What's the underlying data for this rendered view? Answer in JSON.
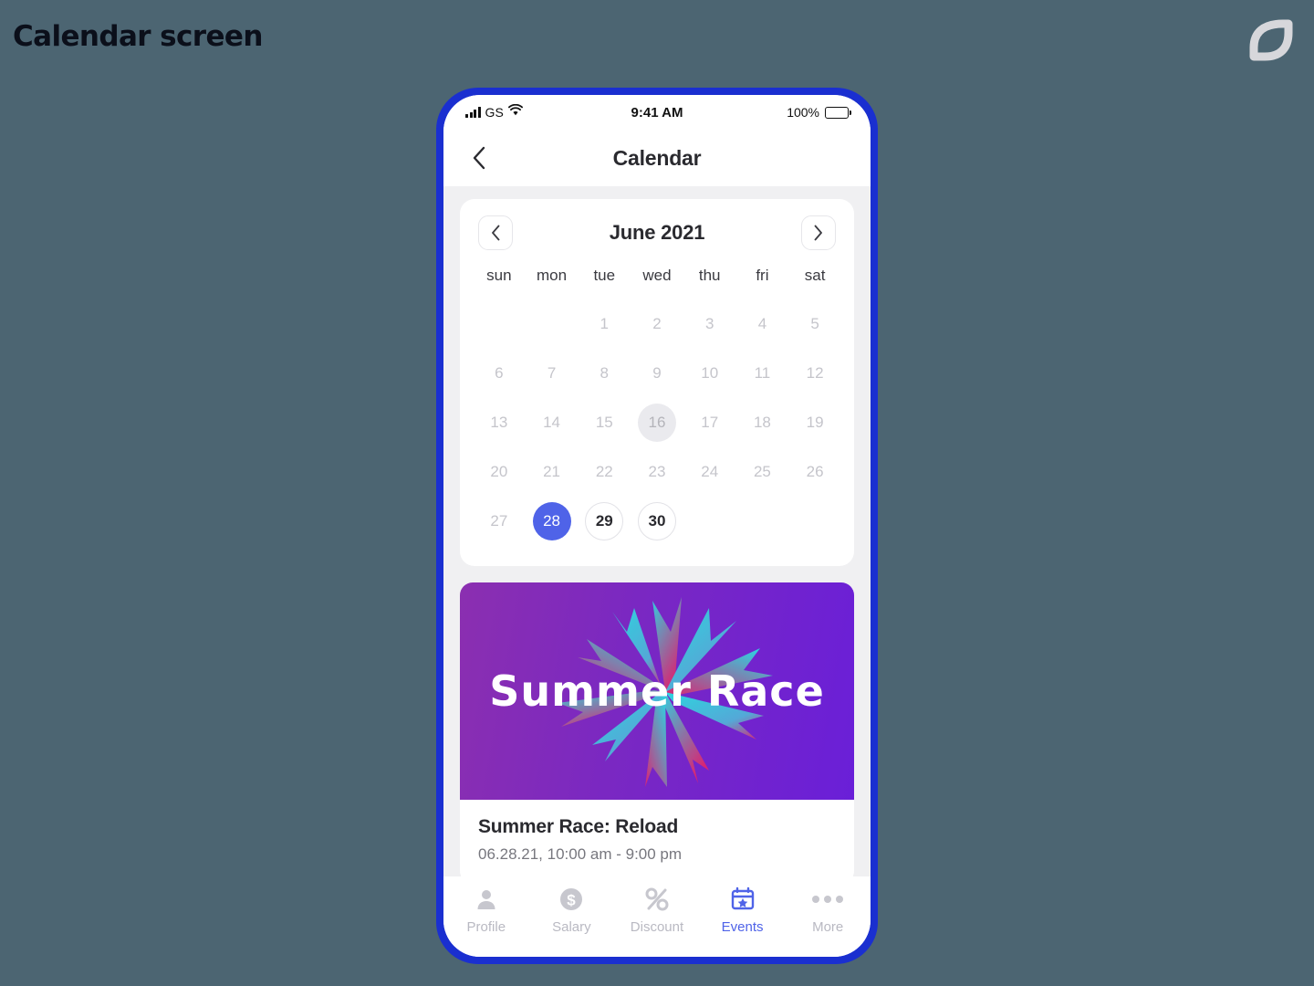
{
  "page": {
    "title": "Calendar screen",
    "logo_icon": "leaf-logo-icon",
    "background_color": "#4c6572",
    "frame_color": "#1a2fd0"
  },
  "status_bar": {
    "carrier": "GS",
    "signal_icon": "signal-bars-icon",
    "wifi_icon": "wifi-icon",
    "time": "9:41 AM",
    "battery_percent": "100%",
    "battery_icon": "battery-full-icon"
  },
  "nav": {
    "back_icon": "chevron-left-icon",
    "title": "Calendar"
  },
  "calendar": {
    "prev_icon": "chevron-left-icon",
    "next_icon": "chevron-right-icon",
    "month_label": "June 2021",
    "weekdays": [
      "sun",
      "mon",
      "tue",
      "wed",
      "thu",
      "fri",
      "sat"
    ],
    "weeks": [
      [
        {
          "label": "",
          "state": "empty"
        },
        {
          "label": "",
          "state": "empty"
        },
        {
          "label": "1",
          "state": "normal"
        },
        {
          "label": "2",
          "state": "normal"
        },
        {
          "label": "3",
          "state": "normal"
        },
        {
          "label": "4",
          "state": "normal"
        },
        {
          "label": "5",
          "state": "normal"
        }
      ],
      [
        {
          "label": "6",
          "state": "normal"
        },
        {
          "label": "7",
          "state": "normal"
        },
        {
          "label": "8",
          "state": "normal"
        },
        {
          "label": "9",
          "state": "normal"
        },
        {
          "label": "10",
          "state": "normal"
        },
        {
          "label": "11",
          "state": "normal"
        },
        {
          "label": "12",
          "state": "normal"
        }
      ],
      [
        {
          "label": "13",
          "state": "normal"
        },
        {
          "label": "14",
          "state": "normal"
        },
        {
          "label": "15",
          "state": "normal"
        },
        {
          "label": "16",
          "state": "today"
        },
        {
          "label": "17",
          "state": "normal"
        },
        {
          "label": "18",
          "state": "normal"
        },
        {
          "label": "19",
          "state": "normal"
        }
      ],
      [
        {
          "label": "20",
          "state": "normal"
        },
        {
          "label": "21",
          "state": "normal"
        },
        {
          "label": "22",
          "state": "normal"
        },
        {
          "label": "23",
          "state": "normal"
        },
        {
          "label": "24",
          "state": "normal"
        },
        {
          "label": "25",
          "state": "normal"
        },
        {
          "label": "26",
          "state": "normal"
        }
      ],
      [
        {
          "label": "27",
          "state": "normal"
        },
        {
          "label": "28",
          "state": "selected"
        },
        {
          "label": "29",
          "state": "outlined"
        },
        {
          "label": "30",
          "state": "outlined"
        },
        {
          "label": "",
          "state": "empty"
        },
        {
          "label": "",
          "state": "empty"
        },
        {
          "label": "",
          "state": "empty"
        }
      ]
    ],
    "selected_color": "#4f63e8",
    "today_color": "#eaeaee"
  },
  "event": {
    "banner_text": "Summer Race",
    "banner_gradient_from": "#8b2fb0",
    "banner_gradient_to": "#6a1fd8",
    "banner_art_icon": "starburst-flower-icon",
    "title": "Summer Race: Reload",
    "subtitle": "06.28.21, 10:00 am - 9:00 pm"
  },
  "tab_bar": {
    "items": [
      {
        "label": "Profile",
        "icon": "person-icon",
        "active": false
      },
      {
        "label": "Salary",
        "icon": "dollar-circle-icon",
        "active": false
      },
      {
        "label": "Discount",
        "icon": "percent-icon",
        "active": false
      },
      {
        "label": "Events",
        "icon": "calendar-star-icon",
        "active": true
      },
      {
        "label": "More",
        "icon": "three-dots-icon",
        "active": false
      }
    ],
    "active_color": "#4f63e8",
    "inactive_color": "#b9b9c2"
  }
}
